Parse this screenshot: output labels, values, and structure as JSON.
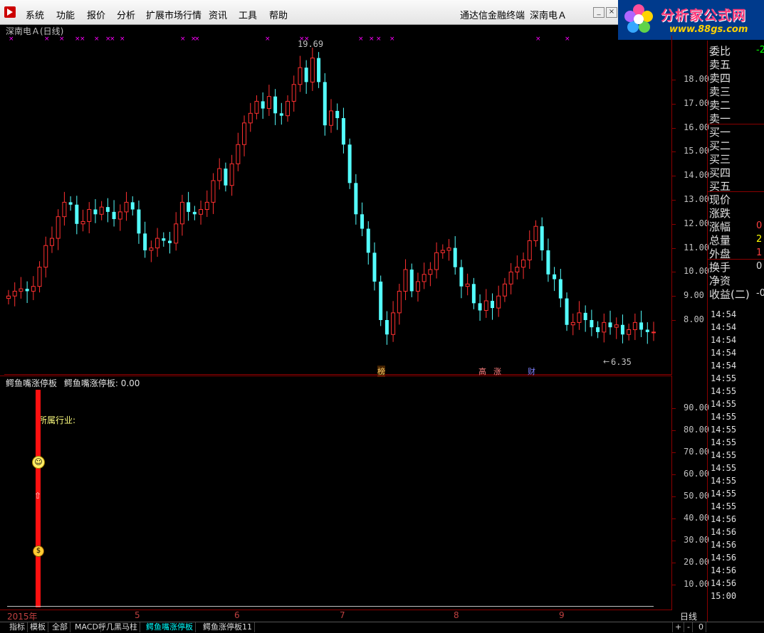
{
  "menubar": {
    "items": [
      "系统",
      "功能",
      "报价",
      "分析",
      "扩展市场行情",
      "资讯",
      "工具",
      "帮助"
    ],
    "right_items": [
      "通达信金融终端",
      "深南电Ａ"
    ]
  },
  "logo": {
    "brand": "分析家公式网",
    "url": "www.88gs.com"
  },
  "chart": {
    "title": "深南电Ａ(日线)",
    "high_label": "19.69",
    "low_label": "6.35",
    "y_ticks": [
      "18.00",
      "17.00",
      "16.00",
      "15.00",
      "14.00",
      "13.00",
      "12.00",
      "11.00",
      "10.00",
      "9.00",
      "8.00"
    ],
    "markers": [
      "榜",
      "高",
      "涨",
      "财"
    ]
  },
  "indicator": {
    "title": "鳄鱼嘴涨停板",
    "name": "鳄鱼嘴涨停板",
    "value": "0.00",
    "industry_label": "所属行业:",
    "y_ticks": [
      "90.00",
      "80.00",
      "70.00",
      "60.00",
      "50.00",
      "40.00",
      "30.00",
      "20.00",
      "10.00"
    ]
  },
  "x_axis": {
    "labels": [
      "2015年",
      "5",
      "6",
      "7",
      "8",
      "9"
    ],
    "period": "日线"
  },
  "side_panel": {
    "rows": [
      {
        "label": "委比",
        "value": "-2",
        "color": "#00ff00"
      },
      {
        "label": "卖五",
        "value": ""
      },
      {
        "label": "卖四",
        "value": ""
      },
      {
        "label": "卖三",
        "value": ""
      },
      {
        "label": "卖二",
        "value": ""
      },
      {
        "label": "卖一",
        "value": ""
      },
      {
        "label": "买一",
        "value": ""
      },
      {
        "label": "买二",
        "value": ""
      },
      {
        "label": "买三",
        "value": ""
      },
      {
        "label": "买四",
        "value": ""
      },
      {
        "label": "买五",
        "value": ""
      },
      {
        "label": "现价",
        "value": ""
      },
      {
        "label": "涨跌",
        "value": ""
      },
      {
        "label": "涨幅",
        "value": "0",
        "color": "#ff4040"
      },
      {
        "label": "总量",
        "value": "2",
        "color": "#ffff00"
      },
      {
        "label": "外盘",
        "value": "1",
        "color": "#ff4040"
      },
      {
        "label": "换手",
        "value": "0",
        "color": "#e0e0e0"
      },
      {
        "label": "净资",
        "value": ""
      },
      {
        "label": "收益(二)",
        "value": "-0",
        "color": "#e0e0e0"
      }
    ],
    "times": [
      "14:54",
      "14:54",
      "14:54",
      "14:54",
      "14:54",
      "14:55",
      "14:55",
      "14:55",
      "14:55",
      "14:55",
      "14:55",
      "14:55",
      "14:55",
      "14:55",
      "14:55",
      "14:55",
      "14:56",
      "14:56",
      "14:56",
      "14:56",
      "14:56",
      "14:56",
      "15:00"
    ]
  },
  "tabs": [
    "指标",
    "模板",
    "全部",
    "MACD",
    "呼几黑马柱",
    "鳄鱼嘴涨停板",
    "鳄鱼涨停板11"
  ],
  "tab_controls": [
    "+",
    "-",
    "0"
  ],
  "colors": {
    "up": "#ff3030",
    "down": "#54ffff",
    "border": "#8b0000",
    "marker": "#ff00ff"
  }
}
